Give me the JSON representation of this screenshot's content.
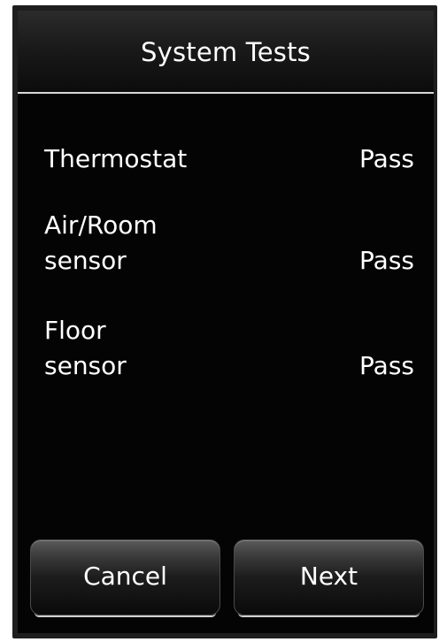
{
  "header": {
    "title": "System Tests"
  },
  "tests": [
    {
      "label_lines": [
        "Thermostat"
      ],
      "status": "Pass"
    },
    {
      "label_lines": [
        "Air/Room",
        "sensor"
      ],
      "status": "Pass"
    },
    {
      "label_lines": [
        "Floor",
        "sensor"
      ],
      "status": "Pass"
    }
  ],
  "buttons": {
    "cancel_label": "Cancel",
    "next_label": "Next"
  },
  "colors": {
    "background": "#040404",
    "text": "#ffffff",
    "divider": "#d8d8d8"
  }
}
